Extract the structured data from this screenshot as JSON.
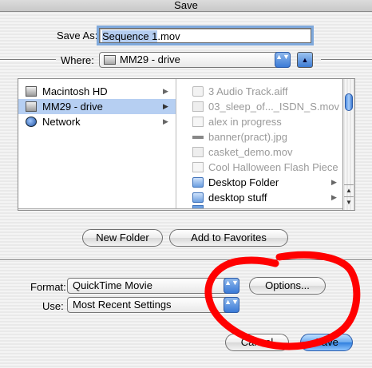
{
  "window": {
    "title": "Save"
  },
  "save_as": {
    "label": "Save As:",
    "filename_selected": "Sequence 1",
    "filename_rest": ".mov"
  },
  "where": {
    "label": "Where:",
    "value": "MM29 - drive",
    "arrows": "▲▼",
    "toggle_glyph": "▲"
  },
  "browser": {
    "col1": [
      {
        "label": "Macintosh HD",
        "icon": "hard-drive-icon",
        "selected": false
      },
      {
        "label": "MM29 - drive",
        "icon": "hard-drive-icon",
        "selected": true
      },
      {
        "label": "Network",
        "icon": "network-globe-icon",
        "selected": false
      }
    ],
    "col1_arrow": "▶",
    "col2": [
      {
        "label": "3 Audio Track.aiff",
        "icon": "audio-file-icon",
        "dim": true
      },
      {
        "label": "03_sleep_of..._ISDN_S.mov",
        "icon": "movie-file-icon",
        "dim": true
      },
      {
        "label": "alex in progress",
        "icon": "document-icon",
        "dim": true
      },
      {
        "label": "banner(pract).jpg",
        "icon": "image-file-icon",
        "dim": true
      },
      {
        "label": "casket_demo.mov",
        "icon": "movie-file-icon",
        "dim": true
      },
      {
        "label": "Cool Halloween Flash Piece",
        "icon": "document-icon",
        "dim": true
      },
      {
        "label": "Desktop Folder",
        "icon": "folder-icon",
        "dim": false
      },
      {
        "label": "desktop stuff",
        "icon": "folder-icon",
        "dim": false
      }
    ]
  },
  "buttons": {
    "new_folder": "New Folder",
    "add_favorites": "Add to Favorites",
    "options": "Options...",
    "cancel": "Cancel",
    "save": "Save"
  },
  "format": {
    "label": "Format:",
    "value": "QuickTime Movie"
  },
  "use": {
    "label": "Use:",
    "value": "Most Recent Settings"
  },
  "colors": {
    "annotation_circle": "#ff0000",
    "accent_blue": "#3b7ad6"
  }
}
